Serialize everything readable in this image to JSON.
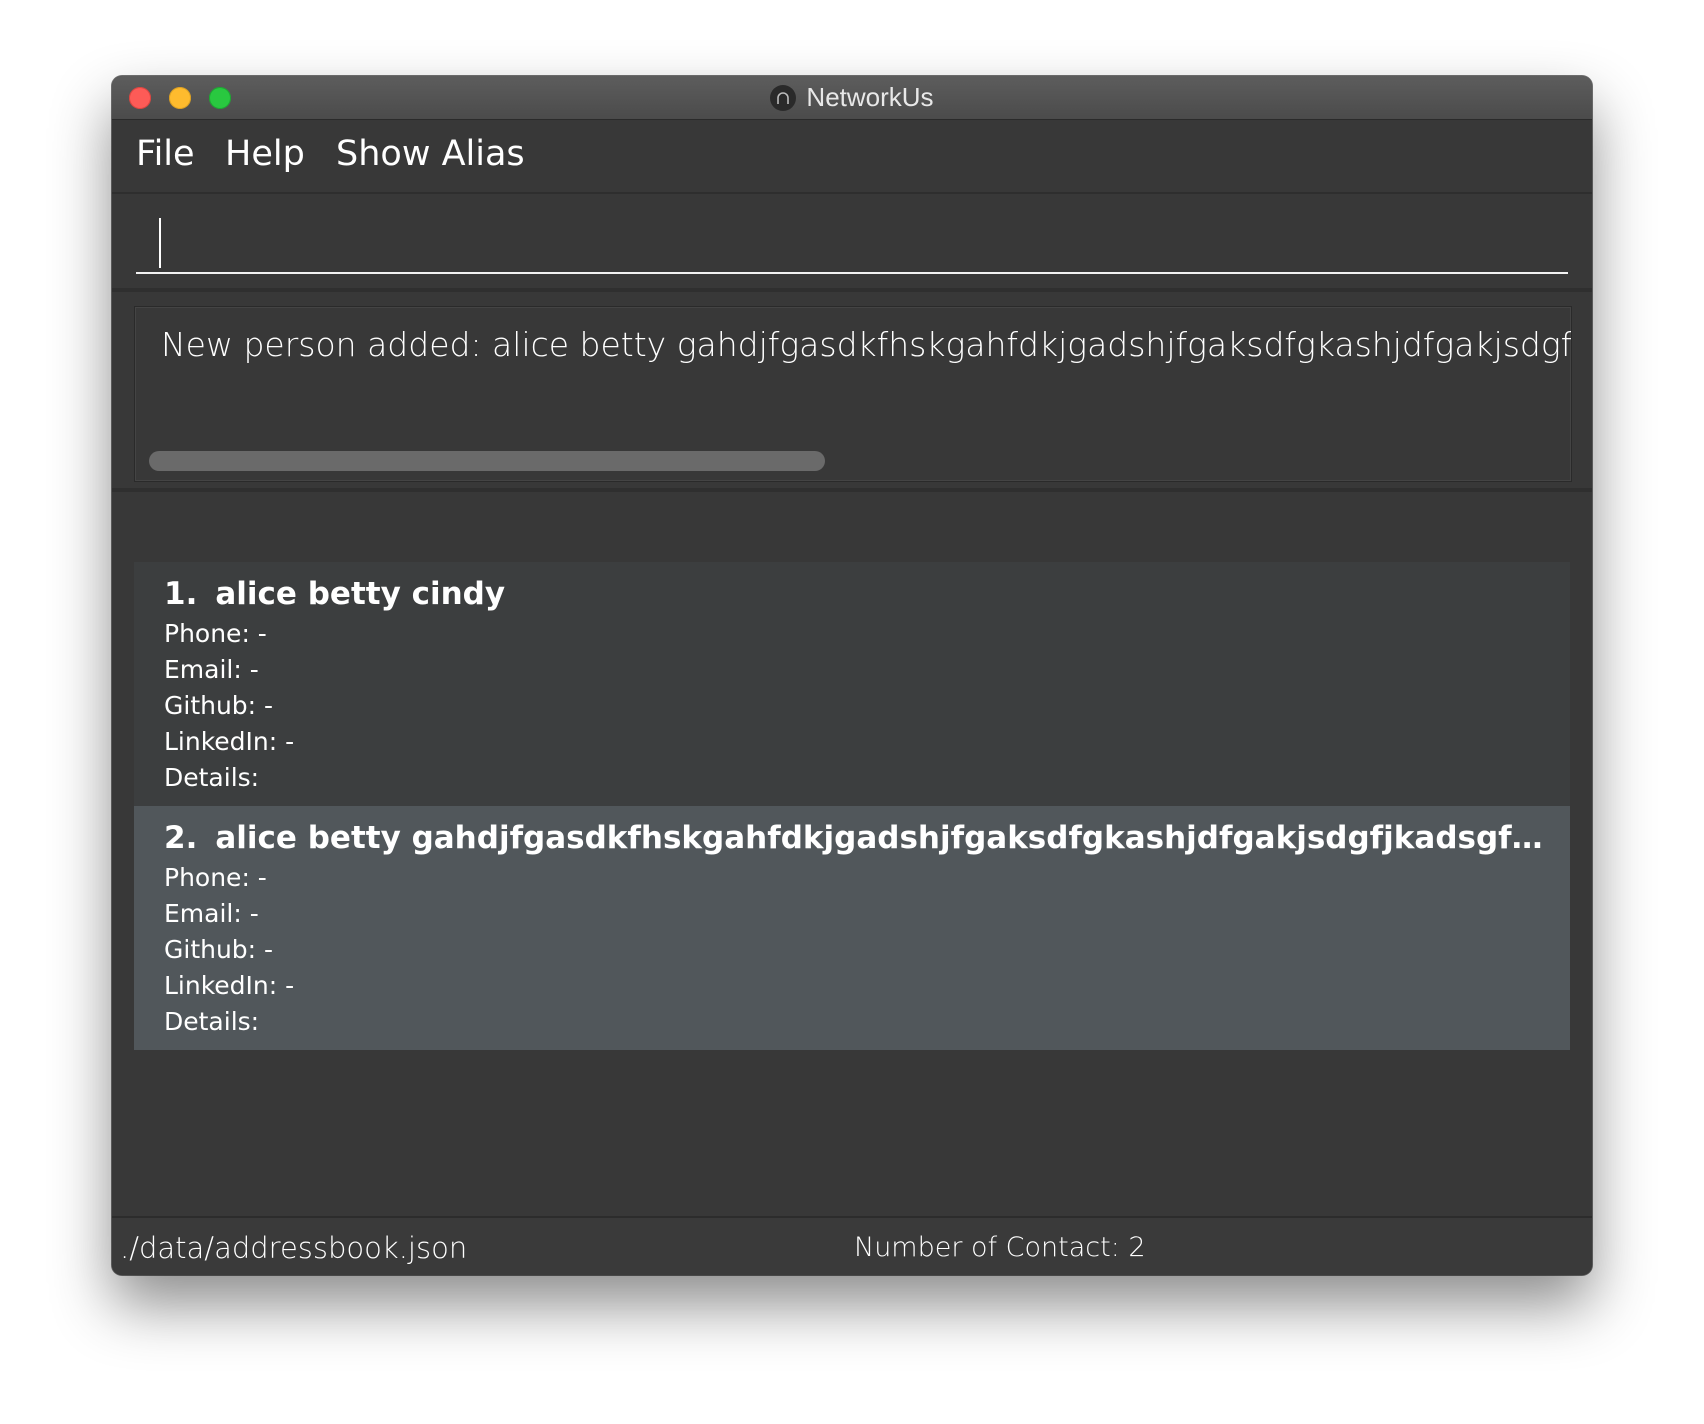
{
  "window": {
    "title": "NetworkUs",
    "app_icon": "networkus-app-icon"
  },
  "menu": {
    "items": [
      {
        "label": "File"
      },
      {
        "label": "Help"
      },
      {
        "label": "Show Alias"
      }
    ]
  },
  "command_box": {
    "value": "",
    "placeholder": ""
  },
  "result_display": {
    "text": "New person added: alice betty gahdjfgasdkfhskgahfdkjgadshjfgaksdfgkashjdfgakjsdgfjkadsg"
  },
  "persons": [
    {
      "index": "1.",
      "name": "alice betty cindy",
      "phone": "Phone: -",
      "email": "Email: -",
      "github": "Github: -",
      "linkedin": "LinkedIn: -",
      "details": "Details:"
    },
    {
      "index": "2.",
      "name": "alice betty gahdjfgasdkfhskgahfdkjgadshjfgaksdfgkashjdfgakjsdgfjkadsgfkdsagfkadgf...",
      "phone": "Phone: -",
      "email": "Email: -",
      "github": "Github: -",
      "linkedin": "LinkedIn: -",
      "details": "Details:"
    }
  ],
  "status_bar": {
    "file_path": "./data/addressbook.json",
    "contact_count": "Number of Contact: 2"
  },
  "colors": {
    "window_bg": "#383838",
    "selected_card": "#51575b",
    "close": "#fd5b57",
    "minimize": "#febb2e",
    "maximize": "#29c840"
  }
}
